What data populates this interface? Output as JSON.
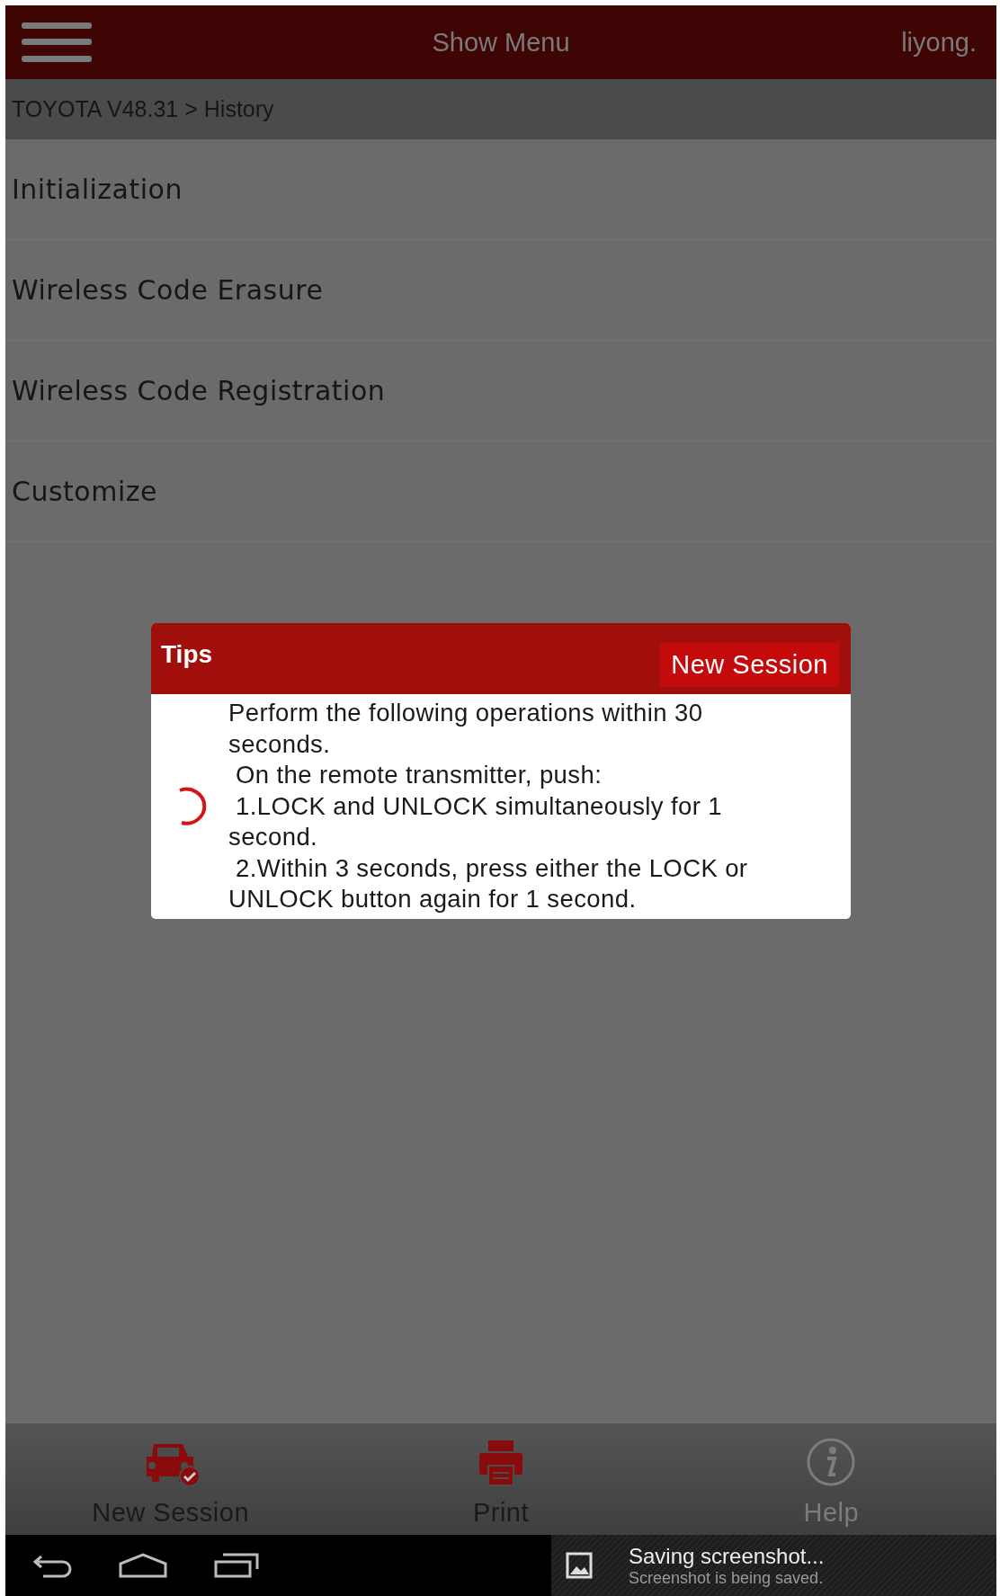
{
  "top_bar": {
    "title": "Show Menu",
    "user": "liyong."
  },
  "breadcrumb": "TOYOTA V48.31 > History",
  "menu_items": [
    {
      "label": "Initialization"
    },
    {
      "label": "Wireless Code Erasure"
    },
    {
      "label": "Wireless Code Registration"
    },
    {
      "label": "Customize"
    }
  ],
  "dialog": {
    "title": "Tips",
    "button": "New Session",
    "message": "Perform the following operations within 30 seconds.\n On the remote transmitter, push:\n 1.LOCK and UNLOCK simultaneously for 1 second.\n 2.Within 3 seconds, press either the LOCK or UNLOCK button again for 1 second."
  },
  "toolbar": [
    {
      "kind": "car",
      "label": "New Session",
      "disabled": false
    },
    {
      "kind": "print",
      "label": "Print",
      "disabled": false
    },
    {
      "kind": "help",
      "label": "Help",
      "disabled": true
    }
  ],
  "notification": {
    "title": "Saving screenshot...",
    "subtitle": "Screenshot is being saved."
  }
}
